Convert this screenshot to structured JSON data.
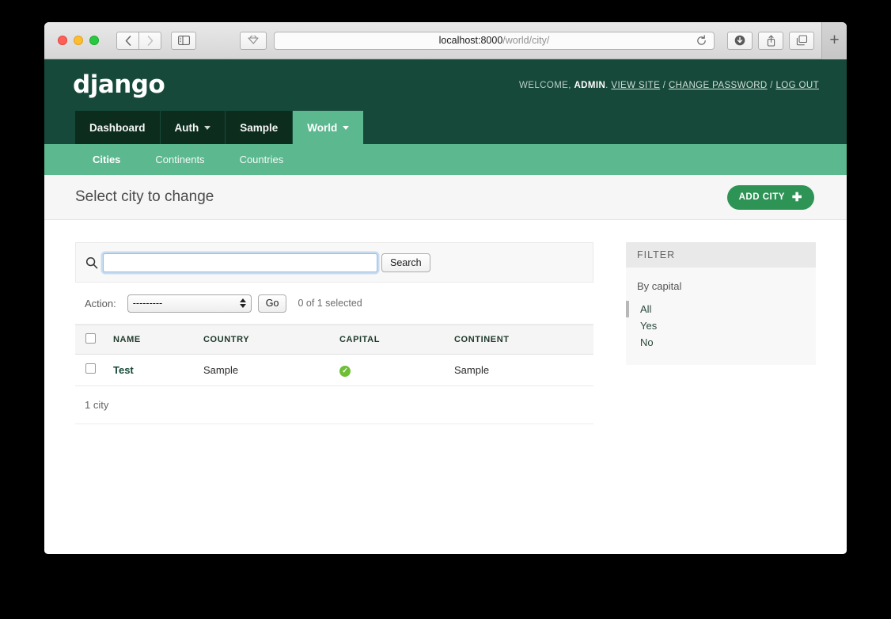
{
  "browser": {
    "url_host": "localhost:8000",
    "url_path": "/world/city/",
    "reload_icon": "reload-icon",
    "back_icon": "back-chevron-icon",
    "forward_icon": "forward-chevron-icon",
    "sidebar_icon": "sidebar-toggle-icon",
    "cloud_icon": "icloud-tabs-icon",
    "downloads_icon": "downloads-icon",
    "share_icon": "share-icon",
    "tabs_icon": "show-tabs-icon",
    "newtab_label": "+"
  },
  "header": {
    "logo": "django",
    "welcome_prefix": "WELCOME,",
    "username": "ADMIN",
    "period": ".",
    "links": [
      {
        "label": "VIEW SITE"
      },
      {
        "label": "CHANGE PASSWORD"
      },
      {
        "label": "LOG OUT"
      }
    ],
    "separator": "/"
  },
  "module_nav": [
    {
      "label": "Dashboard",
      "has_caret": false,
      "active": false
    },
    {
      "label": "Auth",
      "has_caret": true,
      "active": false
    },
    {
      "label": "Sample",
      "has_caret": false,
      "active": false
    },
    {
      "label": "World",
      "has_caret": true,
      "active": true
    }
  ],
  "sub_nav": [
    {
      "label": "Cities",
      "active": true
    },
    {
      "label": "Continents",
      "active": false
    },
    {
      "label": "Countries",
      "active": false
    }
  ],
  "title_bar": {
    "title": "Select city to change",
    "add_button": "ADD CITY",
    "add_icon": "plus-icon"
  },
  "search": {
    "icon": "search-icon",
    "value": "",
    "placeholder": "",
    "submit_label": "Search"
  },
  "actions": {
    "label": "Action:",
    "selected_option": "---------",
    "options": [
      "---------"
    ],
    "go_label": "Go",
    "counter": "0 of 1 selected"
  },
  "table": {
    "columns": [
      "NAME",
      "COUNTRY",
      "CAPITAL",
      "CONTINENT"
    ],
    "rows": [
      {
        "name": "Test",
        "country": "Sample",
        "capital": "yes",
        "continent": "Sample"
      }
    ],
    "paginator": "1 city"
  },
  "filter": {
    "heading": "FILTER",
    "groups": [
      {
        "title": "By capital",
        "options": [
          {
            "label": "All",
            "selected": true
          },
          {
            "label": "Yes",
            "selected": false
          },
          {
            "label": "No",
            "selected": false
          }
        ]
      }
    ]
  },
  "colors": {
    "django_dark_green": "#17493a",
    "django_nav_dark": "#0c2d1e",
    "django_accent_green": "#5cb88f",
    "add_button_green": "#2e9456",
    "bool_yes_green": "#6fbf36"
  }
}
